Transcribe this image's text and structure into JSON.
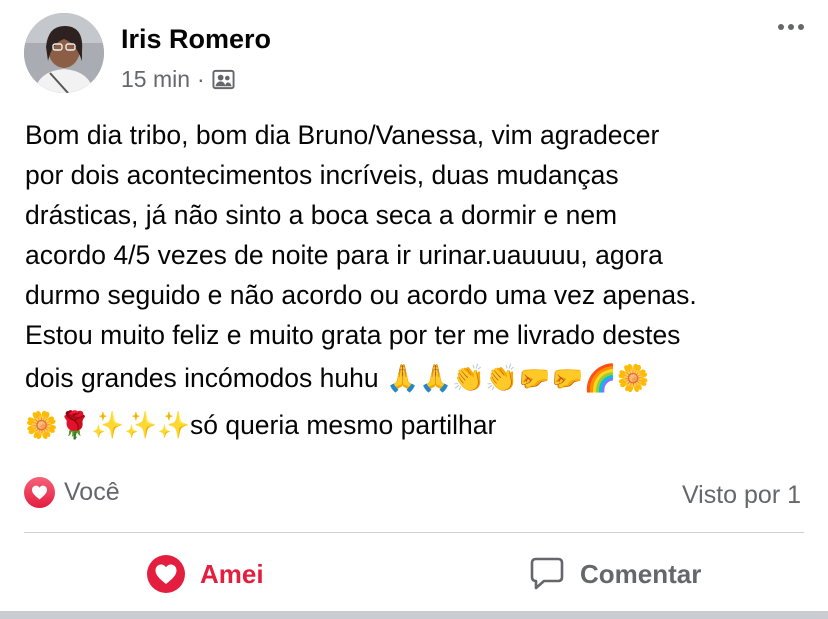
{
  "post": {
    "author": "Iris Romero",
    "time": "15 min",
    "separator": "·",
    "audience_icon": "friends-icon",
    "body_lines": [
      "Bom dia tribo, bom dia Bruno/Vanessa, vim agradecer",
      "por dois acontecimentos incríveis, duas mudanças",
      "drásticas, já não sinto a boca seca a dormir e nem",
      "acordo 4/5 vezes de noite para ir urinar.uauuuu, agora",
      "durmo seguido e não acordo ou acordo uma vez apenas.",
      "Estou muito feliz e muito grata por ter me livrado destes",
      "dois grandes incómodos huhu",
      "só queria mesmo partilhar"
    ],
    "emoji_line_7": "🙏🙏👏👏🤛🤛🌈🌼",
    "emoji_line_8": "🌼🌹✨✨✨"
  },
  "reactions": {
    "reactor": "Você",
    "seen": "Visto por 1",
    "icon": "heart-icon"
  },
  "actions": {
    "love_label": "Amei",
    "comment_label": "Comentar"
  },
  "colors": {
    "love": "#e41e3f",
    "secondary_text": "#65676b",
    "divider": "#ced0d4"
  }
}
